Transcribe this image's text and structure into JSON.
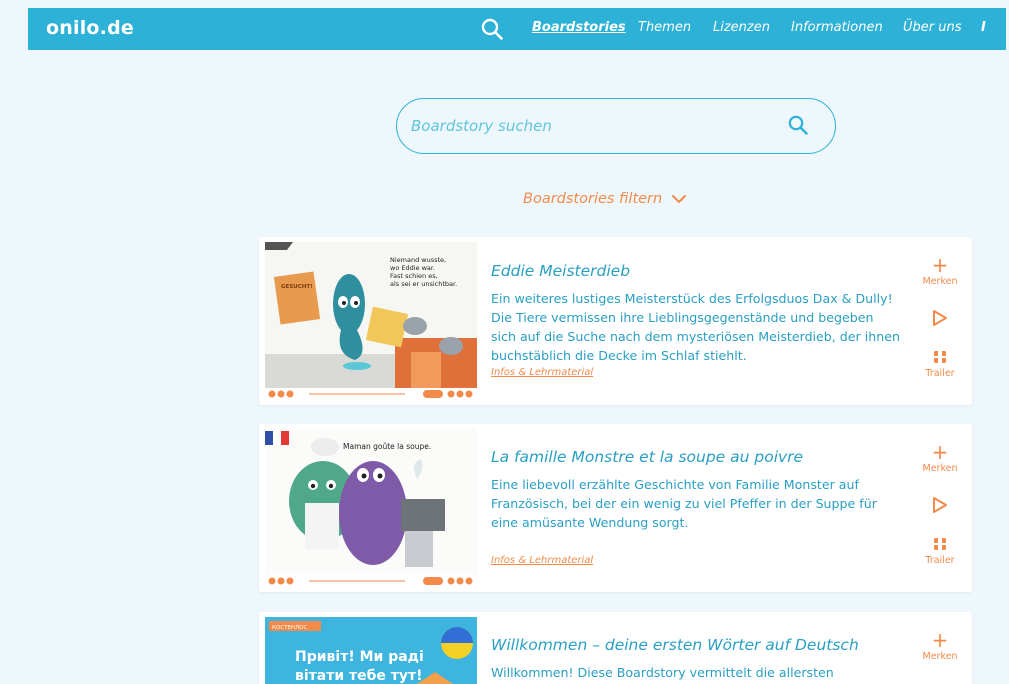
{
  "header": {
    "logo": "onilo.de",
    "nav": [
      {
        "label": "Boardstories",
        "active": true
      },
      {
        "label": "Themen"
      },
      {
        "label": "Lizenzen"
      },
      {
        "label": "Informationen"
      },
      {
        "label": "Über uns"
      },
      {
        "label": "I"
      }
    ]
  },
  "search": {
    "placeholder": "Boardstory suchen"
  },
  "filter": {
    "label": "Boardstories filtern"
  },
  "actions": {
    "merken": "Merken",
    "trailer": "Trailer"
  },
  "cards": [
    {
      "title": "Eddie Meisterdieb",
      "description": "Ein weiteres lustiges Meisterstück des Erfolgsduos Dax & Dully! Die Tiere vermissen ihre Lieblingsgegenstände und begeben sich auf die Suche nach dem mysteriösen Meisterdieb, der ihnen buchstäblich die Decke im Schlaf stiehlt.",
      "infos": "Infos & Lehrmaterial",
      "thumb_text": [
        "Niemand wusste,",
        "wo Eddie war.",
        "Fast schien es,",
        "als sei er unsichtbar."
      ],
      "poster_text": "GESUCHT!"
    },
    {
      "title": "La famille Monstre et la soupe au poivre",
      "description": "Eine liebevoll erzählte Geschichte von Familie Monster auf Französisch, bei der ein wenig zu viel Pfeffer in der Suppe für eine amüsante Wendung sorgt.",
      "infos": "Infos & Lehrmaterial",
      "thumb_text": [
        "Maman goûte la soupe."
      ]
    },
    {
      "title": "Willkommen – deine ersten Wörter auf Deutsch",
      "description": "Willkommen! Diese Boardstory vermittelt die allersten",
      "thumb_tag": "КОСТЕНЛОС",
      "thumb_text": [
        "Привіт! Ми раді",
        "вітати тебе тут!"
      ]
    }
  ],
  "colors": {
    "brand": "#2eb1d6",
    "accent": "#f28a4a",
    "text": "#2a9fc4",
    "background": "#eef8fc"
  }
}
